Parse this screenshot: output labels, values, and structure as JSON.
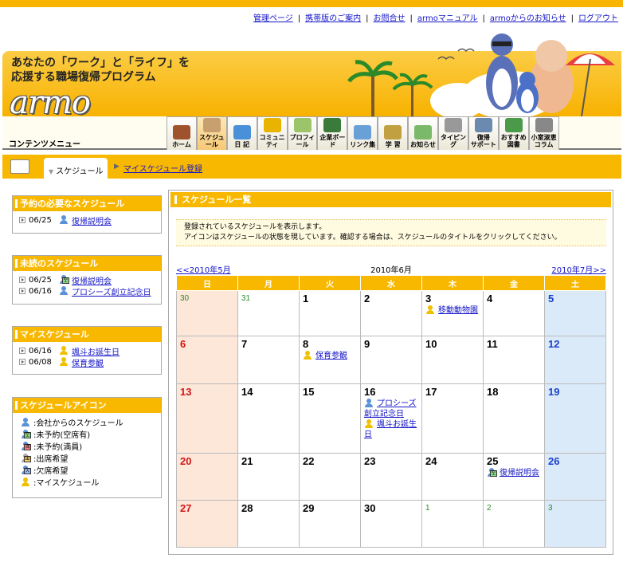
{
  "top_links": [
    "管理ページ",
    "携帯版のご案内",
    "お問合せ",
    "armoマニュアル",
    "armoからのお知らせ",
    "ログアウト"
  ],
  "header": {
    "tagline_line1": "あなたの「ワーク」と「ライフ」を",
    "tagline_line2": "応援する職場復帰プログラム",
    "logo": "armo"
  },
  "nav": {
    "contents_menu": "コンテンツメニュー",
    "items": [
      {
        "label": "ホーム",
        "color": "#a0522d"
      },
      {
        "label": "スケジュール",
        "color": "#c8a070"
      },
      {
        "label": "日 記",
        "color": "#4a90d9"
      },
      {
        "label": "コミュニティ",
        "color": "#e8b400"
      },
      {
        "label": "プロフィール",
        "color": "#9cc46a"
      },
      {
        "label": "企業ボード",
        "color": "#3a7a3a"
      },
      {
        "label": "リンク集",
        "color": "#6aa0d8"
      },
      {
        "label": "学 習",
        "color": "#c0a040"
      },
      {
        "label": "お知らせ",
        "color": "#7ab86a"
      },
      {
        "label": "タイピング",
        "color": "#999999"
      },
      {
        "label": "復帰\nサポート",
        "color": "#6a8ab0"
      },
      {
        "label": "おすすめ\n図書",
        "color": "#4a9a4a"
      },
      {
        "label": "小室淑恵\nコラム",
        "color": "#888888"
      }
    ]
  },
  "breadcrumb": {
    "current": "スケジュール",
    "link": "マイスケジュール登録"
  },
  "sidebar": {
    "needs_reservation": {
      "title": "予約の必要なスケジュール",
      "items": [
        {
          "date": "06/25",
          "title": "復帰説明会",
          "icon": "company"
        }
      ]
    },
    "unread": {
      "title": "未読のスケジュール",
      "items": [
        {
          "date": "06/25",
          "title": "復帰説明会",
          "icon": "avail"
        },
        {
          "date": "06/16",
          "title": "プロシーズ創立記念日",
          "icon": "company"
        }
      ]
    },
    "my_schedule": {
      "title": "マイスケジュール",
      "items": [
        {
          "date": "06/16",
          "title": "颯斗お誕生日",
          "icon": "mine"
        },
        {
          "date": "06/08",
          "title": "保育参観",
          "icon": "mine"
        }
      ]
    },
    "icons": {
      "title": "スケジュールアイコン",
      "items": [
        {
          "label": ":会社からのスケジュール",
          "icon": "company",
          "badge": ""
        },
        {
          "label": ":未予約(空席有)",
          "icon": "avail",
          "badge": "空"
        },
        {
          "label": ":未予約(満員)",
          "icon": "full",
          "badge": "満"
        },
        {
          "label": ":出席希望",
          "icon": "attend",
          "badge": "出"
        },
        {
          "label": ":欠席希望",
          "icon": "absent",
          "badge": "欠"
        },
        {
          "label": ":マイスケジュール",
          "icon": "mine",
          "badge": ""
        }
      ]
    }
  },
  "main": {
    "title": "スケジュール一覧",
    "notice_line1": "登録されているスケジュールを表示します。",
    "notice_line2": "アイコンはスケジュールの状態を現しています。確認する場合は、スケジュールのタイトルをクリックしてください。",
    "prev_month": "<<2010年5月",
    "current_month": "2010年6月",
    "next_month": "2010年7月>>",
    "weekdays": [
      "日",
      "月",
      "火",
      "水",
      "木",
      "金",
      "土"
    ],
    "weeks": [
      [
        {
          "d": "30",
          "o": true
        },
        {
          "d": "31",
          "o": true
        },
        {
          "d": "1"
        },
        {
          "d": "2"
        },
        {
          "d": "3",
          "ev": [
            {
              "t": "移動動物園",
              "i": "mine"
            }
          ]
        },
        {
          "d": "4"
        },
        {
          "d": "5"
        }
      ],
      [
        {
          "d": "6"
        },
        {
          "d": "7"
        },
        {
          "d": "8",
          "ev": [
            {
              "t": "保育参観",
              "i": "mine"
            }
          ]
        },
        {
          "d": "9"
        },
        {
          "d": "10"
        },
        {
          "d": "11"
        },
        {
          "d": "12"
        }
      ],
      [
        {
          "d": "13"
        },
        {
          "d": "14"
        },
        {
          "d": "15"
        },
        {
          "d": "16",
          "ev": [
            {
              "t": "プロシーズ創立記念日",
              "i": "company"
            },
            {
              "t": "颯斗お誕生日",
              "i": "mine"
            }
          ]
        },
        {
          "d": "17"
        },
        {
          "d": "18"
        },
        {
          "d": "19"
        }
      ],
      [
        {
          "d": "20"
        },
        {
          "d": "21"
        },
        {
          "d": "22"
        },
        {
          "d": "23"
        },
        {
          "d": "24"
        },
        {
          "d": "25",
          "ev": [
            {
              "t": "復帰説明会",
              "i": "avail"
            }
          ]
        },
        {
          "d": "26"
        }
      ],
      [
        {
          "d": "27"
        },
        {
          "d": "28"
        },
        {
          "d": "29"
        },
        {
          "d": "30"
        },
        {
          "d": "1",
          "o": true
        },
        {
          "d": "2",
          "o": true
        },
        {
          "d": "3",
          "o": true
        }
      ]
    ]
  }
}
